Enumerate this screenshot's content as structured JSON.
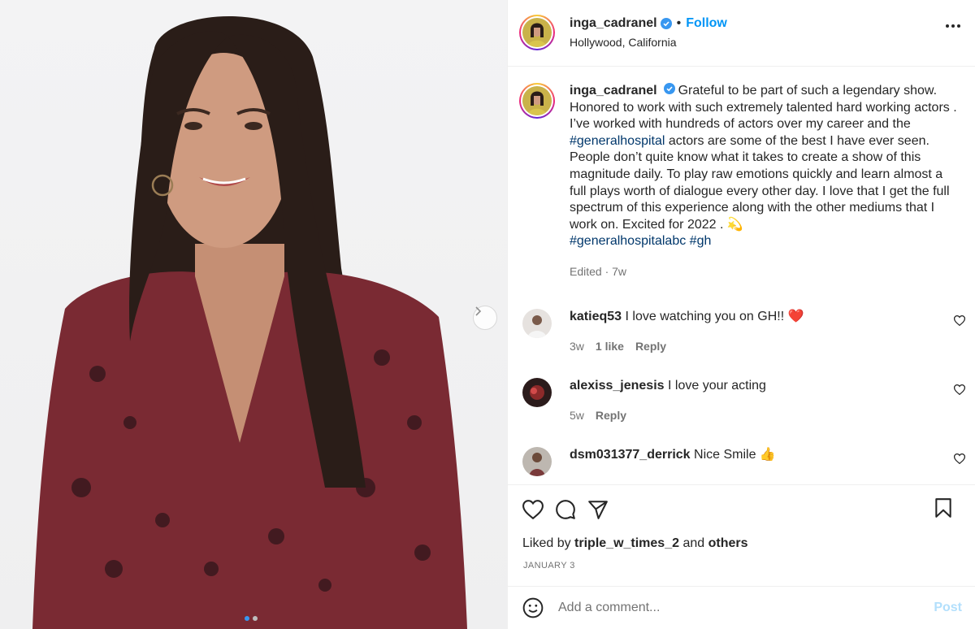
{
  "post": {
    "author": "inga_cadranel",
    "location": "Hollywood, California",
    "follow_label": "Follow",
    "separator": "•",
    "caption": {
      "t1": "Grateful to be part of such a legendary show. Honored to work with such extremely talented hard working actors . I’ve worked with hundreds of actors over my career and the ",
      "tag1": "#generalhospital",
      "t2": " actors are some of the best I have ever seen. People don’t quite know what it takes to create a show of this magnitude daily. To play raw emotions quickly and learn almost a full plays worth of dialogue every other day. I love that I get the full spectrum of this experience along with the other mediums that I work on. Excited for 2022 . 💫",
      "tag2": "#generalhospitalabc",
      "tag3": "#gh"
    },
    "caption_meta": "Edited · 7w",
    "liked_prefix": "Liked by ",
    "liked_user": "triple_w_times_2",
    "liked_and": " and ",
    "liked_others": "others",
    "date": "JANUARY 3"
  },
  "carousel": {
    "current": 1,
    "total": 2
  },
  "comments": [
    {
      "user": "katieq53",
      "text": "I love watching you on GH!! ❤️",
      "age": "3w",
      "likes": "1 like",
      "reply": "Reply"
    },
    {
      "user": "alexiss_jenesis",
      "text": "I love your acting",
      "age": "5w",
      "likes": "",
      "reply": "Reply"
    },
    {
      "user": "dsm031377_derrick",
      "text": "Nice Smile 👍",
      "age": "",
      "likes": "",
      "reply": ""
    }
  ],
  "composer": {
    "placeholder": "Add a comment...",
    "post_label": "Post"
  },
  "icons": [
    "verified-badge-icon",
    "more-options-icon",
    "heart-icon",
    "comment-icon",
    "share-icon",
    "bookmark-icon",
    "emoji-icon",
    "chevron-right-icon"
  ],
  "colors": {
    "accent": "#0095f6",
    "hashtag": "#00376b",
    "muted": "#737373",
    "post_disabled": "#b2dffc",
    "dress": "#7a2a33"
  }
}
